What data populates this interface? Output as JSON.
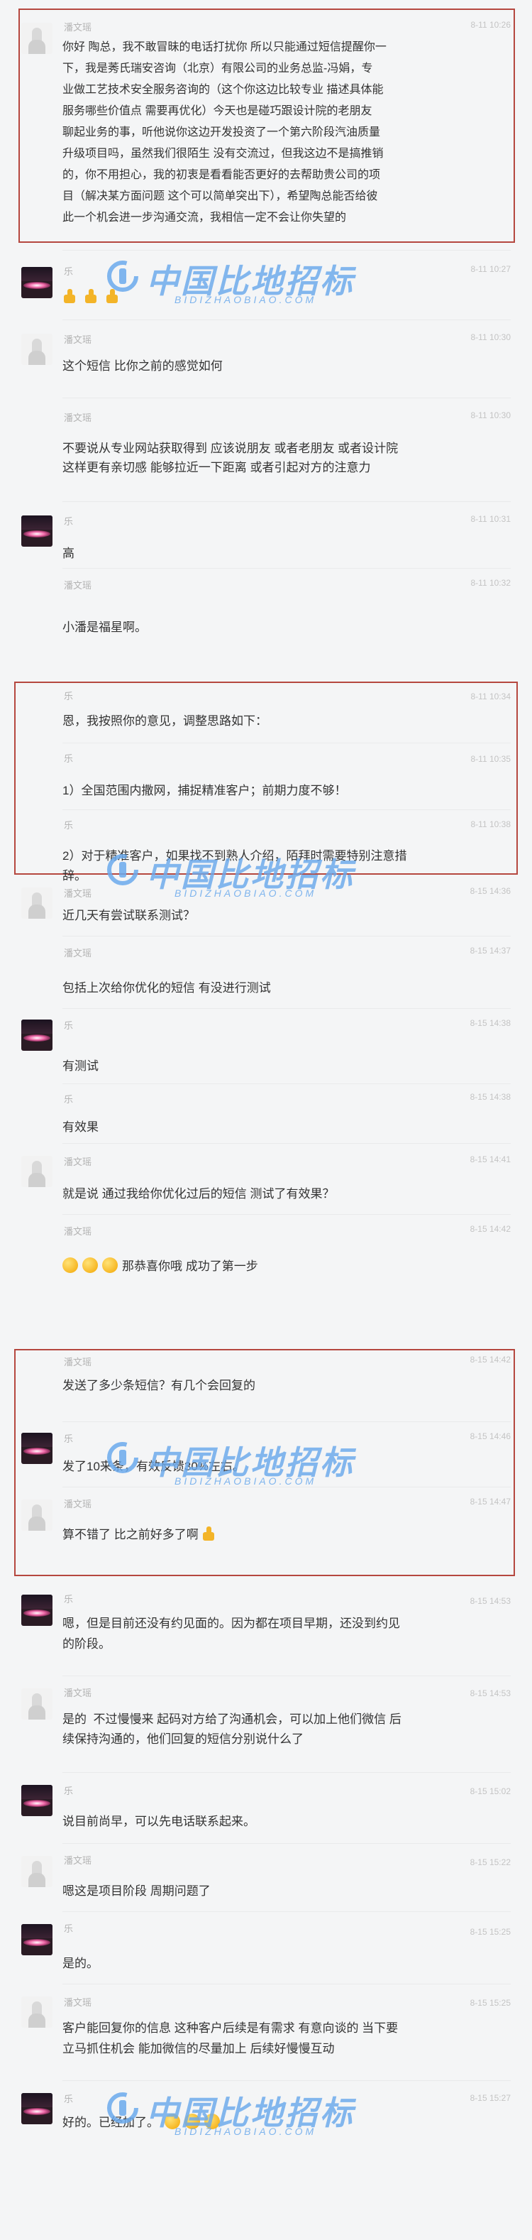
{
  "watermark": {
    "title": "中国比地招标",
    "subtitle": "BIDIZHAOBIAO.COM",
    "color": "#6aa9ec"
  },
  "m1": {
    "name": "潘文瑶",
    "time": "8-11 10:26",
    "text": "你好 陶总，我不敢冒昧的电话打扰你 所以只能通过短信提醒你一\n下，我是莠氏瑞安咨询（北京）有限公司的业务总监-冯娟，专\n业做工艺技术安全服务咨询的（这个你这边比较专业 描述具体能\n服务哪些价值点 需要再优化）今天也是碰巧跟设计院的老朋友\n聊起业务的事，听他说你这边开发投资了一个第六阶段汽油质量\n升级项目吗，虽然我们很陌生 没有交流过，但我这边不是搞推销\n的，你不用担心，我的初衷是看看能否更好的去帮助贵公司的项\n目（解决某方面问题 这个可以简单突出下），希望陶总能否给彼\n此一个机会进一步沟通交流，我相信一定不会让你失望的"
  },
  "m2": {
    "name": "乐",
    "time": "8-11 10:27"
  },
  "m3": {
    "name": "潘文瑶",
    "time": "8-11 10:30",
    "text": "这个短信 比你之前的感觉如何"
  },
  "m4": {
    "name": "潘文瑶",
    "time": "8-11 10:30",
    "text": "不要说从专业网站获取得到 应该说朋友 或者老朋友 或者设计院\n这样更有亲切感 能够拉近一下距离 或者引起对方的注意力"
  },
  "m5": {
    "name": "乐",
    "time": "8-11 10:31",
    "text": "高"
  },
  "m6": {
    "name": "潘文瑶",
    "time": "8-11 10:32",
    "text": "小潘是福星啊。"
  },
  "m7": {
    "name": "乐",
    "time": "8-11 10:34",
    "text": "恩，我按照你的意见，调整思路如下："
  },
  "m8": {
    "name": "乐",
    "time": "8-11 10:35",
    "text": "1）全国范围内撒网，捕捉精准客户；前期力度不够！"
  },
  "m9": {
    "name": "乐",
    "time": "8-11 10:38",
    "text": "2）对于精准客户，如果找不到熟人介绍，陌拜时需要特别注意措\n辞。"
  },
  "m10": {
    "name": "潘文瑶",
    "time": "8-15 14:36",
    "text": "近几天有尝试联系测试？"
  },
  "m11": {
    "name": "潘文瑶",
    "time": "8-15 14:37",
    "text": "包括上次给你优化的短信 有没进行测试"
  },
  "m12": {
    "name": "乐",
    "time": "8-15 14:38",
    "text": "有测试"
  },
  "m13": {
    "name": "乐",
    "time": "8-15 14:38",
    "text": "有效果"
  },
  "m14": {
    "name": "潘文瑶",
    "time": "8-15 14:41",
    "text": "就是说 通过我给你优化过后的短信 测试了有效果？"
  },
  "m15": {
    "name": "潘文瑶",
    "time": "8-15 14:42",
    "text": "那恭喜你哦 成功了第一步"
  },
  "m16": {
    "name": "潘文瑶",
    "time": "8-15 14:42",
    "text": "发送了多少条短信？有几个会回复的"
  },
  "m17": {
    "name": "乐",
    "time": "8-15 14:46",
    "text": "发了10来条，有效反馈30%左右。"
  },
  "m18": {
    "name": "潘文瑶",
    "time": "8-15 14:47",
    "text": "算不错了 比之前好多了啊"
  },
  "m19": {
    "name": "乐",
    "time": "8-15 14:53",
    "text": "嗯，但是目前还没有约见面的。因为都在项目早期，还没到约见\n的阶段。"
  },
  "m20": {
    "name": "潘文瑶",
    "time": "8-15 14:53",
    "text": "是的  不过慢慢来 起码对方给了沟通机会，可以加上他们微信 后\n续保持沟通的，他们回复的短信分别说什么了"
  },
  "m21": {
    "name": "乐",
    "time": "8-15 15:02",
    "text": "说目前尚早，可以先电话联系起来。"
  },
  "m22": {
    "name": "潘文瑶",
    "time": "8-15 15:22",
    "text": "嗯这是项目阶段 周期问题了"
  },
  "m23": {
    "name": "乐",
    "time": "8-15 15:25",
    "text": "是的。"
  },
  "m24": {
    "name": "潘文瑶",
    "time": "8-15 15:25",
    "text": "客户能回复你的信息 这种客户后续是有需求 有意向谈的 当下要\n立马抓住机会 能加微信的尽量加上 后续好慢慢互动"
  },
  "m25": {
    "name": "乐",
    "time": "8-15 15:27",
    "text": "好的。已经加了。"
  }
}
